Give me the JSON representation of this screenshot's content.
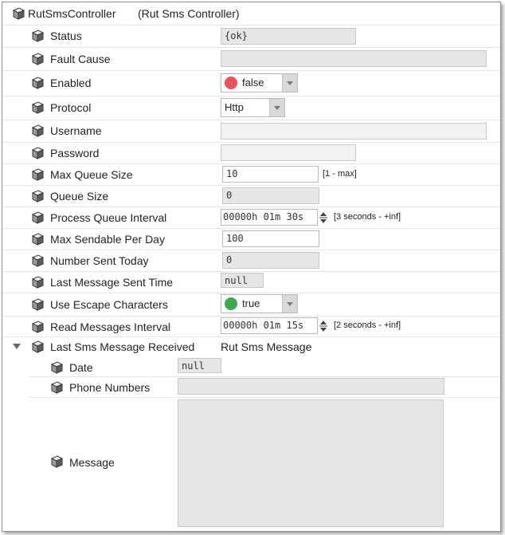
{
  "header": {
    "title": "RutSmsController",
    "subtitle": "(Rut Sms Controller)"
  },
  "colors": {
    "false_dot": "#e8525a",
    "true_dot": "#3eaa4e"
  },
  "rows": {
    "status": {
      "label": "Status",
      "value": "{ok}"
    },
    "fault_cause": {
      "label": "Fault Cause",
      "value": ""
    },
    "enabled": {
      "label": "Enabled",
      "value": "false"
    },
    "protocol": {
      "label": "Protocol",
      "value": "Http"
    },
    "username": {
      "label": "Username",
      "value": ""
    },
    "password": {
      "label": "Password",
      "value": ""
    },
    "max_queue_size": {
      "label": "Max Queue Size",
      "value": "10",
      "range": "[1 - max]"
    },
    "queue_size": {
      "label": "Queue Size",
      "value": "0"
    },
    "process_queue_interval": {
      "label": "Process Queue Interval",
      "value": "00000h 01m 30s",
      "range": "[3 seconds - +inf]"
    },
    "max_sendable_per_day": {
      "label": "Max Sendable Per Day",
      "value": "100"
    },
    "number_sent_today": {
      "label": "Number Sent Today",
      "value": "0"
    },
    "last_message_sent_time": {
      "label": "Last Message Sent Time",
      "value": "null"
    },
    "use_escape_characters": {
      "label": "Use Escape Characters",
      "value": "true"
    },
    "read_messages_interval": {
      "label": "Read Messages Interval",
      "value": "00000h 01m 15s",
      "range": "[2 seconds - +inf]"
    },
    "last_sms_message_received": {
      "label": "Last Sms Message Received",
      "value": "Rut Sms Message"
    }
  },
  "children": {
    "date": {
      "label": "Date",
      "value": "null"
    },
    "phone_numbers": {
      "label": "Phone Numbers",
      "value": ""
    },
    "message": {
      "label": "Message",
      "value": ""
    }
  }
}
